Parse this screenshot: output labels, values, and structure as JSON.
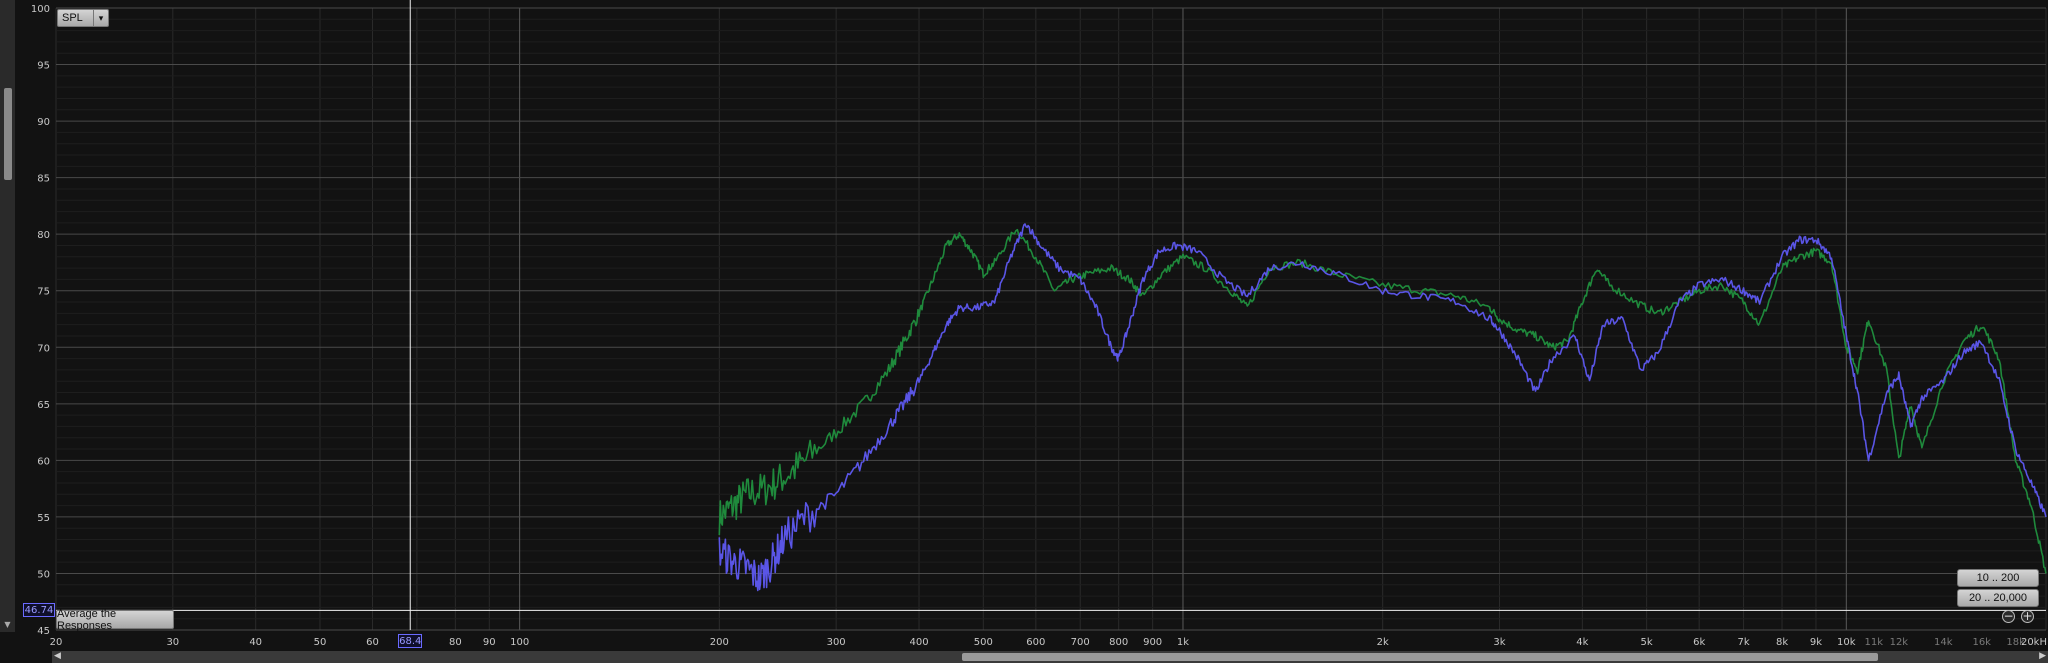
{
  "toolbar": {
    "spl_select_value": "SPL",
    "dropdown_arrow": "▾",
    "average_button_label": "Average the Responses",
    "range_button_1": "10 .. 200",
    "range_button_2": "20 .. 20,000",
    "zoom_out_symbol": "−",
    "zoom_in_symbol": "+"
  },
  "cursor": {
    "y_readout": "46.74",
    "x_readout": "68.4",
    "freq": 68.4,
    "spl": 46.74
  },
  "colors": {
    "background": "#121212",
    "grid_major": "#4a4a4a",
    "grid_minor": "#2a2a2a",
    "series_green": "#1f8a3c",
    "series_blue": "#5a55e6",
    "cursor": "#f0f0f0",
    "axis_text": "#c8c8c8"
  },
  "chart_data": {
    "type": "line",
    "x_scale": "log",
    "xlim": [
      20,
      20000
    ],
    "ylim": [
      45,
      100
    ],
    "grid": true,
    "x_tick_labels": [
      {
        "v": 20,
        "t": "20"
      },
      {
        "v": 30,
        "t": "30"
      },
      {
        "v": 40,
        "t": "40"
      },
      {
        "v": 50,
        "t": "50"
      },
      {
        "v": 60,
        "t": "60"
      },
      {
        "v": 80,
        "t": "80"
      },
      {
        "v": 90,
        "t": "90"
      },
      {
        "v": 100,
        "t": "100"
      },
      {
        "v": 200,
        "t": "200"
      },
      {
        "v": 300,
        "t": "300"
      },
      {
        "v": 400,
        "t": "400"
      },
      {
        "v": 500,
        "t": "500"
      },
      {
        "v": 600,
        "t": "600"
      },
      {
        "v": 700,
        "t": "700"
      },
      {
        "v": 800,
        "t": "800"
      },
      {
        "v": 900,
        "t": "900"
      },
      {
        "v": 1000,
        "t": "1k"
      },
      {
        "v": 2000,
        "t": "2k"
      },
      {
        "v": 3000,
        "t": "3k"
      },
      {
        "v": 4000,
        "t": "4k"
      },
      {
        "v": 5000,
        "t": "5k"
      },
      {
        "v": 6000,
        "t": "6k"
      },
      {
        "v": 7000,
        "t": "7k"
      },
      {
        "v": 8000,
        "t": "8k"
      },
      {
        "v": 9000,
        "t": "9k"
      },
      {
        "v": 10000,
        "t": "10k"
      },
      {
        "v": 11000,
        "t": "11k"
      },
      {
        "v": 12000,
        "t": "12k"
      },
      {
        "v": 14000,
        "t": "14k"
      },
      {
        "v": 16000,
        "t": "16k"
      },
      {
        "v": 18000,
        "t": "18k"
      },
      {
        "v": 20000,
        "t": "20kH"
      }
    ],
    "y_tick_labels": [
      {
        "v": 100,
        "t": "100"
      },
      {
        "v": 95,
        "t": "95"
      },
      {
        "v": 90,
        "t": "90"
      },
      {
        "v": 85,
        "t": "85"
      },
      {
        "v": 80,
        "t": "80"
      },
      {
        "v": 75,
        "t": "75"
      },
      {
        "v": 70,
        "t": "70"
      },
      {
        "v": 65,
        "t": "65"
      },
      {
        "v": 60,
        "t": "60"
      },
      {
        "v": 55,
        "t": "55"
      },
      {
        "v": 50,
        "t": "50"
      },
      {
        "v": 45,
        "t": "45"
      }
    ],
    "series": [
      {
        "color": "#1f8a3c",
        "points": [
          [
            200,
            55.0
          ],
          [
            210,
            56.0
          ],
          [
            220,
            57.0
          ],
          [
            235,
            57.5
          ],
          [
            250,
            58.5
          ],
          [
            270,
            60.0
          ],
          [
            300,
            62.5
          ],
          [
            330,
            65.0
          ],
          [
            360,
            68.0
          ],
          [
            380,
            70.5
          ],
          [
            400,
            73.0
          ],
          [
            420,
            76.0
          ],
          [
            440,
            79.0
          ],
          [
            460,
            80.0
          ],
          [
            480,
            78.5
          ],
          [
            500,
            76.5
          ],
          [
            520,
            77.5
          ],
          [
            560,
            80.5
          ],
          [
            600,
            78.0
          ],
          [
            640,
            75.0
          ],
          [
            680,
            76.0
          ],
          [
            720,
            76.5
          ],
          [
            780,
            77.0
          ],
          [
            830,
            76.0
          ],
          [
            870,
            74.5
          ],
          [
            930,
            76.5
          ],
          [
            1000,
            78.0
          ],
          [
            1080,
            77.0
          ],
          [
            1180,
            75.0
          ],
          [
            1250,
            73.5
          ],
          [
            1350,
            77.0
          ],
          [
            1500,
            77.5
          ],
          [
            1700,
            76.5
          ],
          [
            2000,
            75.5
          ],
          [
            2300,
            75.0
          ],
          [
            2600,
            74.5
          ],
          [
            2900,
            73.5
          ],
          [
            3000,
            72.5
          ],
          [
            3200,
            71.5
          ],
          [
            3400,
            71.0
          ],
          [
            3600,
            70.0
          ],
          [
            3800,
            70.5
          ],
          [
            4000,
            74.0
          ],
          [
            4200,
            77.0
          ],
          [
            4400,
            75.5
          ],
          [
            4800,
            74.0
          ],
          [
            5200,
            73.0
          ],
          [
            5600,
            74.0
          ],
          [
            6000,
            75.0
          ],
          [
            6500,
            75.5
          ],
          [
            7000,
            74.0
          ],
          [
            7400,
            72.0
          ],
          [
            8000,
            77.0
          ],
          [
            8500,
            78.0
          ],
          [
            9000,
            78.5
          ],
          [
            9500,
            77.5
          ],
          [
            10000,
            70.0
          ],
          [
            10400,
            68.0
          ],
          [
            10800,
            72.5
          ],
          [
            11500,
            68.0
          ],
          [
            12000,
            60.0
          ],
          [
            12500,
            65.0
          ],
          [
            13000,
            61.0
          ],
          [
            14000,
            67.0
          ],
          [
            15000,
            70.5
          ],
          [
            16000,
            72.0
          ],
          [
            17000,
            69.0
          ],
          [
            18000,
            60.0
          ],
          [
            19000,
            56.0
          ],
          [
            20000,
            50.0
          ]
        ]
      },
      {
        "color": "#5a55e6",
        "points": [
          [
            200,
            52.0
          ],
          [
            210,
            51.0
          ],
          [
            220,
            50.5
          ],
          [
            230,
            49.5
          ],
          [
            240,
            51.0
          ],
          [
            250,
            53.0
          ],
          [
            270,
            55.0
          ],
          [
            300,
            57.0
          ],
          [
            330,
            60.0
          ],
          [
            360,
            63.0
          ],
          [
            380,
            65.0
          ],
          [
            400,
            67.0
          ],
          [
            420,
            69.5
          ],
          [
            440,
            72.0
          ],
          [
            460,
            73.5
          ],
          [
            490,
            73.5
          ],
          [
            520,
            74.0
          ],
          [
            550,
            78.0
          ],
          [
            580,
            81.0
          ],
          [
            610,
            79.0
          ],
          [
            650,
            77.0
          ],
          [
            700,
            76.0
          ],
          [
            740,
            73.5
          ],
          [
            780,
            70.0
          ],
          [
            800,
            69.0
          ],
          [
            830,
            72.0
          ],
          [
            870,
            76.0
          ],
          [
            920,
            78.5
          ],
          [
            980,
            79.0
          ],
          [
            1050,
            78.5
          ],
          [
            1150,
            76.0
          ],
          [
            1250,
            74.5
          ],
          [
            1350,
            77.0
          ],
          [
            1500,
            77.5
          ],
          [
            1700,
            76.5
          ],
          [
            2000,
            75.0
          ],
          [
            2300,
            74.5
          ],
          [
            2600,
            74.0
          ],
          [
            2900,
            72.5
          ],
          [
            3000,
            71.5
          ],
          [
            3200,
            69.0
          ],
          [
            3400,
            66.0
          ],
          [
            3600,
            69.0
          ],
          [
            3900,
            71.0
          ],
          [
            4100,
            67.0
          ],
          [
            4300,
            72.0
          ],
          [
            4600,
            72.5
          ],
          [
            4900,
            68.0
          ],
          [
            5200,
            69.5
          ],
          [
            5600,
            74.0
          ],
          [
            6000,
            75.5
          ],
          [
            6500,
            76.0
          ],
          [
            7000,
            75.0
          ],
          [
            7400,
            74.0
          ],
          [
            8000,
            78.0
          ],
          [
            8500,
            79.5
          ],
          [
            9000,
            79.5
          ],
          [
            9500,
            78.0
          ],
          [
            10000,
            71.0
          ],
          [
            10400,
            66.0
          ],
          [
            10800,
            60.0
          ],
          [
            11500,
            66.0
          ],
          [
            12000,
            67.5
          ],
          [
            12500,
            63.0
          ],
          [
            13000,
            65.5
          ],
          [
            14000,
            67.0
          ],
          [
            15000,
            69.5
          ],
          [
            16000,
            70.5
          ],
          [
            17000,
            67.0
          ],
          [
            18000,
            61.0
          ],
          [
            19000,
            58.0
          ],
          [
            20000,
            55.0
          ]
        ]
      }
    ]
  }
}
